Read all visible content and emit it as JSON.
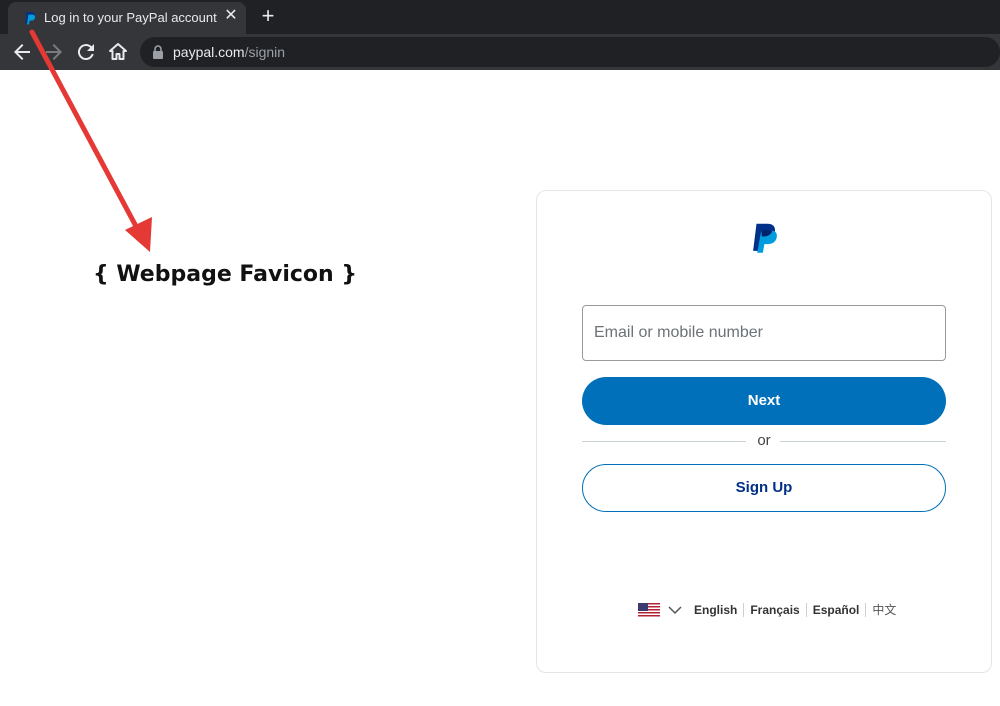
{
  "browser": {
    "tab_title": "Log in to your PayPal account",
    "tab_close": "✕",
    "new_tab": "+",
    "url_host": "paypal.com",
    "url_path": "/signin"
  },
  "annotation": {
    "label": "{ Webpage Favicon }",
    "arrow_color": "#e53935"
  },
  "login": {
    "email_placeholder": "Email or mobile number",
    "email_value": "",
    "next_label": "Next",
    "or_label": "or",
    "signup_label": "Sign Up"
  },
  "languages": [
    "English",
    "Français",
    "Español",
    "中文"
  ],
  "colors": {
    "paypal_dark_blue": "#003087",
    "paypal_blue": "#0070ba",
    "paypal_light_blue": "#009cde"
  }
}
